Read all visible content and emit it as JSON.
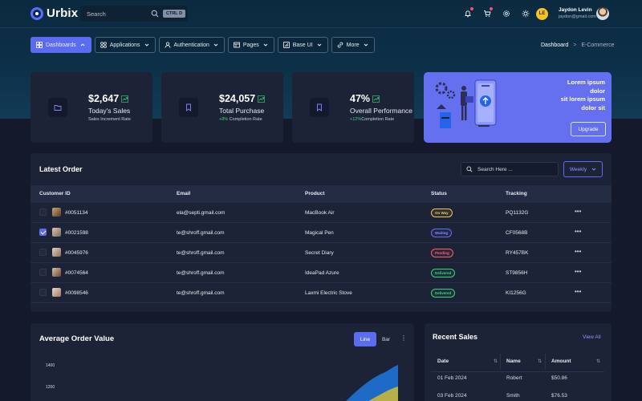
{
  "app": {
    "name": "Urbix"
  },
  "search": {
    "placeholder": "Search",
    "shortcut": "CTRL D"
  },
  "user": {
    "name": "Jaydon Levin",
    "email": "jaydon@gmail.com",
    "initials": "LE"
  },
  "nav": {
    "items": [
      {
        "label": "Dashboards",
        "icon": "grid-icon",
        "active": true
      },
      {
        "label": "Applications",
        "icon": "apps-icon"
      },
      {
        "label": "Authentication",
        "icon": "user-icon"
      },
      {
        "label": "Pages",
        "icon": "pages-icon"
      },
      {
        "label": "Base UI",
        "icon": "base-ui-icon"
      },
      {
        "label": "More",
        "icon": "link-icon"
      }
    ]
  },
  "breadcrumb": {
    "home": "Dashboard",
    "separator": ">",
    "current": "E-Commerce"
  },
  "stats": [
    {
      "value": "$2,647",
      "label": "Today's Sales",
      "sub_prefix": "",
      "sub": "Sales Increment Rate",
      "icon": "folder-icon"
    },
    {
      "value": "$24,057",
      "label": "Total Purchase",
      "sub_prefix": "+8%",
      "sub": " Completion Rate",
      "icon": "bookmark-icon"
    },
    {
      "value": "47%",
      "label": "Overall Performance",
      "sub_prefix": "+12%",
      "sub": "Completion Rate",
      "icon": "bookmark-icon"
    }
  ],
  "promo": {
    "lines": [
      "Lorem ipsum",
      "dolor",
      "sit lorem ipsum",
      "dolor sit"
    ],
    "button": "Upgrade"
  },
  "orders": {
    "title": "Latest Order",
    "search_placeholder": "Search Here ...",
    "filter": "Weekly",
    "columns": [
      "Customer ID",
      "Email",
      "Product",
      "Status",
      "Tracking"
    ],
    "rows": [
      {
        "id": "#0051134",
        "email": "ela@septi.gmail.com",
        "product": "MacBook Air",
        "status": "On Way",
        "status_type": "onway",
        "tracking": "PQ1132G",
        "checked": false
      },
      {
        "id": "#0021598",
        "email": "te@shroff.gmail.com",
        "product": "Magical Pen",
        "status": "Waiting",
        "status_type": "waiting",
        "tracking": "CF0568B",
        "checked": true
      },
      {
        "id": "#0045976",
        "email": "te@shroff.gmail.com",
        "product": "Secret Diary",
        "status": "Pending",
        "status_type": "pending",
        "tracking": "RY457BK",
        "checked": false
      },
      {
        "id": "#0074564",
        "email": "te@shroff.gmail.com",
        "product": "IdeaPad Azure",
        "status": "Delivered",
        "status_type": "delivered",
        "tracking": "ST9856H",
        "checked": false
      },
      {
        "id": "#0098546",
        "email": "te@shroff.gmail.com",
        "product": "Laxmi Electric Stove",
        "status": "Delivered",
        "status_type": "delivered",
        "tracking": "KI1256G",
        "checked": false
      }
    ]
  },
  "avg_order": {
    "title": "Average Order Value",
    "toggle": [
      "Line",
      "Bar"
    ],
    "active_toggle": "Line"
  },
  "chart_data": {
    "type": "area",
    "title": "Average Order Value",
    "y_ticks": [
      1400,
      1200
    ],
    "series_colors": [
      "#1e6fd0",
      "#c9b73a"
    ]
  },
  "recent_sales": {
    "title": "Recent Sales",
    "view_all": "View All",
    "columns": [
      "Date",
      "Name",
      "Amount"
    ],
    "rows": [
      {
        "date": "01 Feb 2024",
        "name": "Robert",
        "amount": "$50.86"
      },
      {
        "date": "03 Feb 2024",
        "name": "Smith",
        "amount": "$76.53"
      }
    ]
  }
}
